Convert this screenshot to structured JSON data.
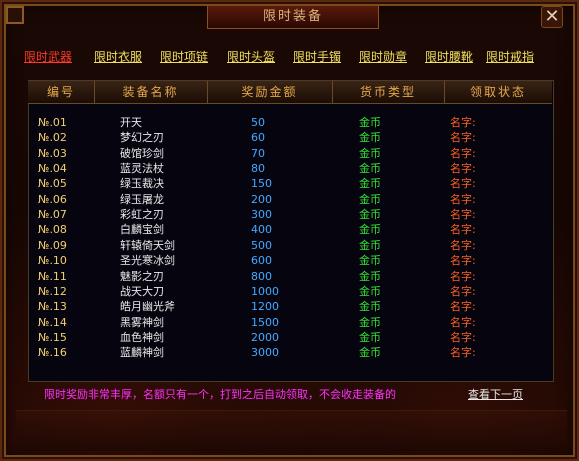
{
  "window": {
    "title": "限时装备",
    "close_symbol": "✕"
  },
  "tabs": [
    {
      "label": "限时武器",
      "active": true
    },
    {
      "label": "限时衣服",
      "active": false
    },
    {
      "label": "限时项链",
      "active": false
    },
    {
      "label": "限时头盔",
      "active": false
    },
    {
      "label": "限时手镯",
      "active": false
    },
    {
      "label": "限时勋章",
      "active": false
    },
    {
      "label": "限时腰靴",
      "active": false
    },
    {
      "label": "限时戒指",
      "active": false
    }
  ],
  "table": {
    "headers": [
      "编号",
      "装备名称",
      "奖励金额",
      "货币类型",
      "领取状态"
    ],
    "rows": [
      {
        "num": "№.01",
        "name": "开天",
        "amount": "50",
        "currency": "金币",
        "receiver": "名字:"
      },
      {
        "num": "№.02",
        "name": "梦幻之刃",
        "amount": "60",
        "currency": "金币",
        "receiver": "名字:"
      },
      {
        "num": "№.03",
        "name": "破馆珍剑",
        "amount": "70",
        "currency": "金币",
        "receiver": "名字:"
      },
      {
        "num": "№.04",
        "name": "蓝灵法杖",
        "amount": "80",
        "currency": "金币",
        "receiver": "名字:"
      },
      {
        "num": "№.05",
        "name": "绿玉裁决",
        "amount": "150",
        "currency": "金币",
        "receiver": "名字:"
      },
      {
        "num": "№.06",
        "name": "绿玉屠龙",
        "amount": "200",
        "currency": "金币",
        "receiver": "名字:"
      },
      {
        "num": "№.07",
        "name": "彩虹之刃",
        "amount": "300",
        "currency": "金币",
        "receiver": "名字:"
      },
      {
        "num": "№.08",
        "name": "白麟宝剑",
        "amount": "400",
        "currency": "金币",
        "receiver": "名字:"
      },
      {
        "num": "№.09",
        "name": "轩辕倚天剑",
        "amount": "500",
        "currency": "金币",
        "receiver": "名字:"
      },
      {
        "num": "№.10",
        "name": "圣光寒冰剑",
        "amount": "600",
        "currency": "金币",
        "receiver": "名字:"
      },
      {
        "num": "№.11",
        "name": "魅影之刃",
        "amount": "800",
        "currency": "金币",
        "receiver": "名字:"
      },
      {
        "num": "№.12",
        "name": "战天大刀",
        "amount": "1000",
        "currency": "金币",
        "receiver": "名字:"
      },
      {
        "num": "№.13",
        "name": "皓月幽光斧",
        "amount": "1200",
        "currency": "金币",
        "receiver": "名字:"
      },
      {
        "num": "№.14",
        "name": "黑雾神剑",
        "amount": "1500",
        "currency": "金币",
        "receiver": "名字:"
      },
      {
        "num": "№.15",
        "name": "血色神剑",
        "amount": "2000",
        "currency": "金币",
        "receiver": "名字:"
      },
      {
        "num": "№.16",
        "name": "蓝麟神剑",
        "amount": "3000",
        "currency": "金币",
        "receiver": "名字:"
      }
    ]
  },
  "footer": {
    "note": "限时奖励非常丰厚，名额只有一个，打到之后自动领取，不会收走装备的",
    "next_page": "查看下一页"
  },
  "colors": {
    "tab_active": "#ff3a2a",
    "tab": "#f0e060",
    "header": "#e6a84a",
    "number": "#f0d070",
    "name": "#e8e8e8",
    "amount": "#44a8ff",
    "currency": "#30e030",
    "receiver": "#ff6020",
    "note": "#ff30ff"
  }
}
